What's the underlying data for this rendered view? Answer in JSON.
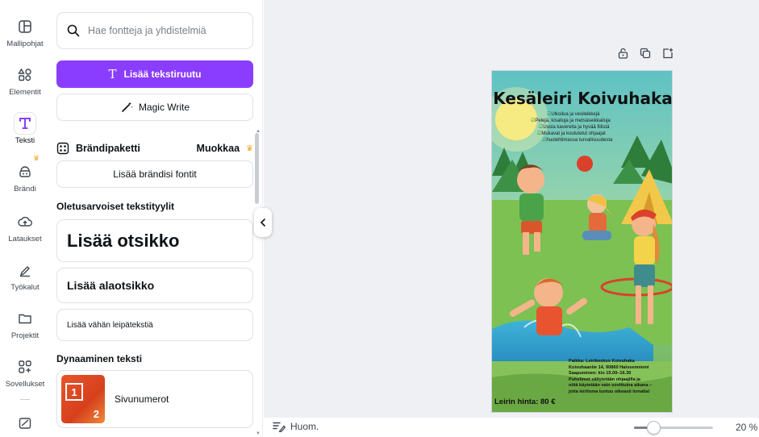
{
  "rail": {
    "items": [
      {
        "label": "Mallipohjat",
        "icon": "templates-icon"
      },
      {
        "label": "Elementit",
        "icon": "elements-icon"
      },
      {
        "label": "Teksti",
        "icon": "text-icon"
      },
      {
        "label": "Brändi",
        "icon": "brand-icon"
      },
      {
        "label": "Lataukset",
        "icon": "uploads-icon"
      },
      {
        "label": "Työkalut",
        "icon": "tools-icon"
      },
      {
        "label": "Projektit",
        "icon": "projects-icon"
      },
      {
        "label": "Sovellukset",
        "icon": "apps-icon"
      }
    ],
    "active": "Teksti"
  },
  "panel": {
    "search_placeholder": "Hae fontteja ja yhdistelmiä",
    "add_textbox_label": "Lisää tekstiruutu",
    "magic_write_label": "Magic Write",
    "brand_kit_label": "Brändipaketti",
    "brand_edit_label": "Muokkaa",
    "add_brand_fonts_label": "Lisää brändisi fontit",
    "default_styles_heading": "Oletusarvoiset tekstityylit",
    "add_heading_label": "Lisää otsikko",
    "add_subheading_label": "Lisää alaotsikko",
    "add_body_label": "Lisää vähän leipätekstiä",
    "dynamic_heading": "Dynaaminen teksti",
    "page_numbers_label": "Sivunumerot",
    "thumb_num1": "1",
    "thumb_num2": "2"
  },
  "poster": {
    "title": "Kesäleiri Koivuhaka",
    "list": [
      "Ulkoilua ja vesileikkejä",
      "Pelejä, kisailuja ja metsäseikkailuja",
      "Uusia kavereita ja hyvää fiilistä",
      "Mukavat ja koulutetut ohjaajat",
      "huolehtimassa turvallisuudesta"
    ],
    "info": [
      "Paikka: Leirikeskus Koivuhaka",
      "Koivuhaantie 14, 90860 Halosenniemi",
      "Saapuminen: klo 15.00–16.30",
      "Puhelimet säilytetään ohjaajilla ja",
      "niitä käytetään vain sovittuina aikana –",
      "jotta leiriloma tuntuu oikeasti lomalta!"
    ],
    "price": "Leirin hinta: 80 €"
  },
  "bottom": {
    "notes_label": "Huom.",
    "zoom_value": "20 %",
    "zoom_fraction": 0.2
  },
  "colors": {
    "accent": "#8b3dff",
    "crown": "#f5a524",
    "canvas_bg": "#eef0f4"
  }
}
